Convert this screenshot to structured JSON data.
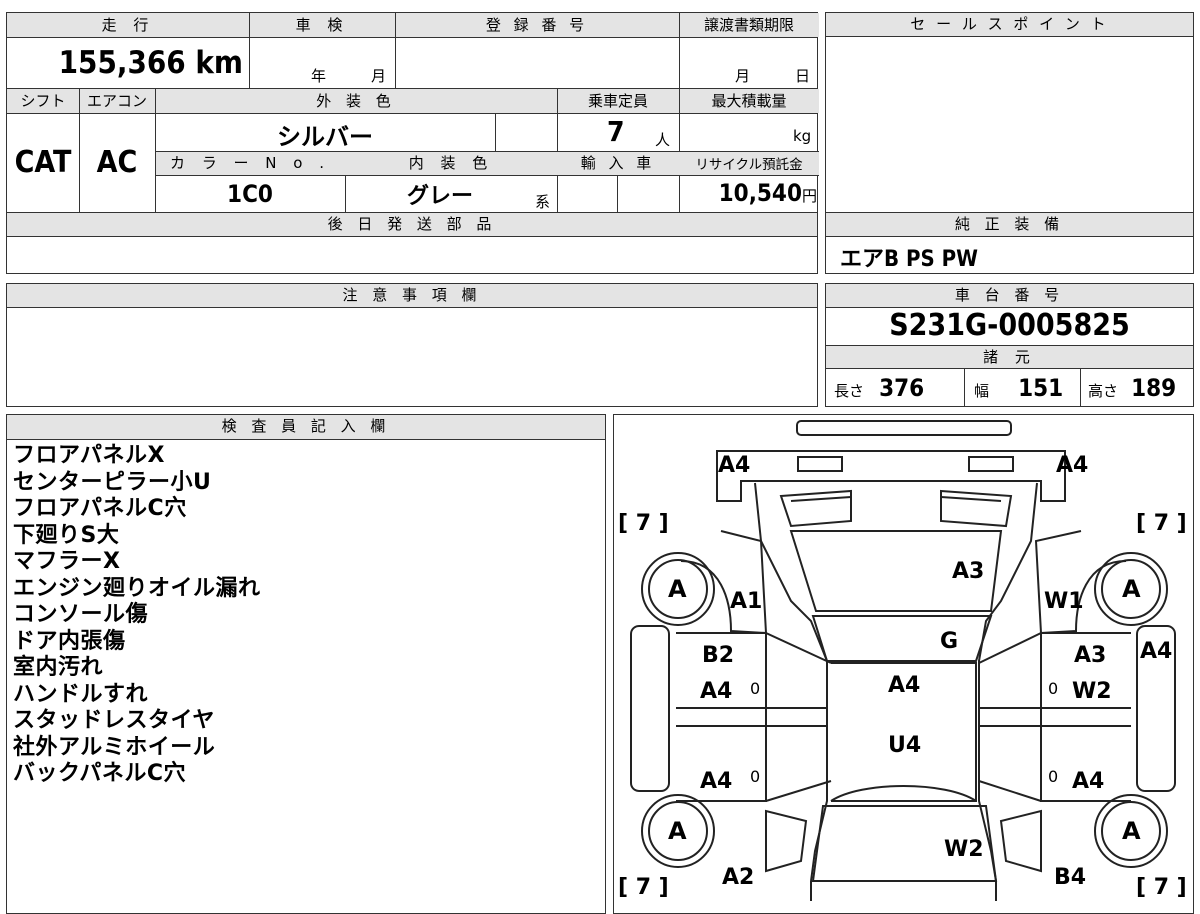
{
  "labels": {
    "mileage": "走 行",
    "shaken": "車 検",
    "reg_number": "登 録 番 号",
    "transfer_deadline": "譲渡書類期限",
    "sale_point": "セ ー ル ス ポ イ ン ト",
    "shift": "シフト",
    "aircon": "エアコン",
    "exterior_color": "外 装 色",
    "capacity": "乗車定員",
    "max_load": "最大積載量",
    "color_no": "カ ラ ー N o .",
    "interior_color": "内 装 色",
    "import": "輸 入 車",
    "recycle": "リサイクル預託金",
    "later_parts": "後 日 発 送 部 品",
    "genuine_equipment": "純 正 装 備",
    "caution": "注 意 事 項 欄",
    "chassis_number": "車 台 番 号",
    "specs": "諸 元",
    "inspector": "検 査 員 記 入 欄"
  },
  "values": {
    "mileage": "155,366",
    "mileage_unit": "km",
    "shaken_year": "年",
    "shaken_month": "月",
    "transfer_month": "月",
    "transfer_day": "日",
    "shift": "CAT",
    "aircon": "AC",
    "exterior_color": "シルバー",
    "capacity": "7",
    "capacity_unit": "人",
    "max_load_unit": "kg",
    "color_no": "1C0",
    "interior_color": "グレー",
    "interior_suffix": "系",
    "recycle": "10,540",
    "recycle_unit": "円",
    "equipment": "エアB PS PW",
    "chassis_number": "S231G-0005825",
    "length_label": "長さ",
    "length": "376",
    "width_label": "幅",
    "width": "151",
    "height_label": "高さ",
    "height": "189"
  },
  "inspector_notes": [
    "フロアパネルX",
    "センターピラー小U",
    "フロアパネルC穴",
    "下廻りS大",
    "マフラーX",
    "エンジン廻りオイル漏れ",
    "コンソール傷",
    "ドア内張傷",
    "室内汚れ",
    "ハンドルすれ",
    "スタッドレスタイヤ",
    "社外アルミホイール",
    "バックパネルC穴"
  ],
  "diagram": {
    "tire_label": "A",
    "tread": "[ 7 ]",
    "marks": {
      "front_left": "A4",
      "front_right": "A4",
      "hood": "A3",
      "left_fender": "A1",
      "right_fender": "W1",
      "windshield": "G",
      "left_front_door_b": "B2",
      "left_front_door_a": "A4",
      "right_front_door_a": "A3",
      "right_front_door_w": "W2",
      "right_side": "A4",
      "roof": "A4",
      "roof_u": "U4",
      "left_rear_door": "A4",
      "right_rear_door": "A4",
      "rear_panel": "W2",
      "left_rear": "A2",
      "right_rear": "B4",
      "zero": "0"
    }
  }
}
